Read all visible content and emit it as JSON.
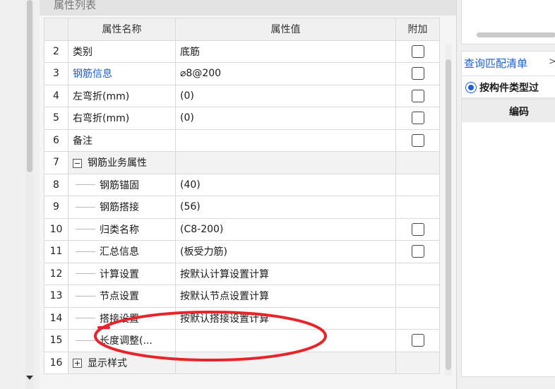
{
  "panel": {
    "title": "属性列表"
  },
  "grid": {
    "headers": {
      "name": "属性名称",
      "value": "属性值",
      "extra": "附加"
    },
    "rows": [
      {
        "num": "2",
        "name": "类别",
        "value": "底筋",
        "checkbox": true
      },
      {
        "num": "3",
        "name": "钢筋信息",
        "value": "⌀8@200",
        "checkbox": true,
        "link": true
      },
      {
        "num": "4",
        "name": "左弯折(mm)",
        "value": "(0)",
        "checkbox": true
      },
      {
        "num": "5",
        "name": "右弯折(mm)",
        "value": "(0)",
        "checkbox": true
      },
      {
        "num": "6",
        "name": "备注",
        "value": "",
        "checkbox": true
      },
      {
        "num": "7",
        "name": "钢筋业务属性",
        "value": "",
        "checkbox": false,
        "group": "expanded"
      },
      {
        "num": "8",
        "name": "钢筋锚固",
        "value": "(40)",
        "checkbox": false,
        "child": true
      },
      {
        "num": "9",
        "name": "钢筋搭接",
        "value": "(56)",
        "checkbox": false,
        "child": true
      },
      {
        "num": "10",
        "name": "归类名称",
        "value": "(C8-200)",
        "checkbox": true,
        "child": true
      },
      {
        "num": "11",
        "name": "汇总信息",
        "value": "(板受力筋)",
        "checkbox": true,
        "child": true
      },
      {
        "num": "12",
        "name": "计算设置",
        "value": "按默认计算设置计算",
        "checkbox": false,
        "child": true
      },
      {
        "num": "13",
        "name": "节点设置",
        "value": "按默认节点设置计算",
        "checkbox": false,
        "child": true
      },
      {
        "num": "14",
        "name": "搭接设置",
        "value": "按默认搭接设置计算",
        "checkbox": false,
        "child": true
      },
      {
        "num": "15",
        "name": "长度调整(...",
        "value": "",
        "checkbox": true,
        "child": true
      },
      {
        "num": "16",
        "name": "显示样式",
        "value": "",
        "checkbox": false,
        "group": "collapsed"
      }
    ]
  },
  "right_panel": {
    "tab_label": "查询匹配清单",
    "tab_more": ">",
    "radio_label": "按构件类型过",
    "column_header": "编码"
  },
  "colors": {
    "link": "#1a5fd6",
    "annotation": "#e8242a"
  }
}
